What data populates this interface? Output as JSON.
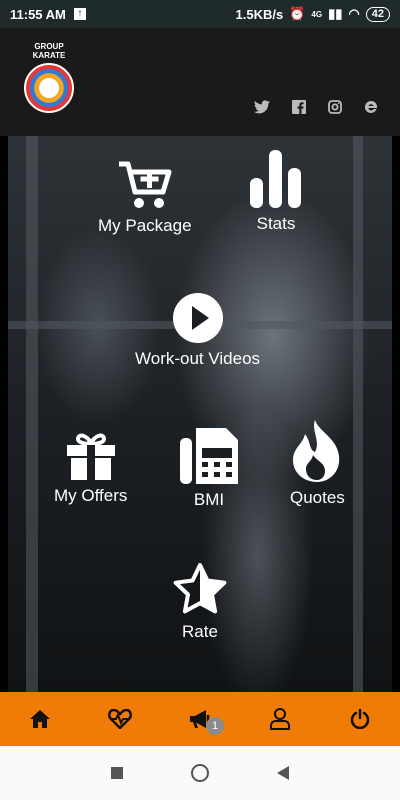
{
  "status_bar": {
    "time": "11:55 AM",
    "speed": "1.5KB/s",
    "network": "4G",
    "battery": "42"
  },
  "header": {
    "logo_text_line1": "GROUP",
    "logo_text_line2": "KARATE",
    "social": [
      "twitter-icon",
      "facebook-icon",
      "instagram-icon",
      "browser-icon"
    ]
  },
  "menu": {
    "my_package": "My Package",
    "stats": "Stats",
    "workout_videos": "Work-out Videos",
    "my_offers": "My Offers",
    "bmi": "BMI",
    "quotes": "Quotes",
    "rate": "Rate"
  },
  "bottom_nav": {
    "notification_count": "1"
  },
  "colors": {
    "accent": "#f07c07"
  }
}
